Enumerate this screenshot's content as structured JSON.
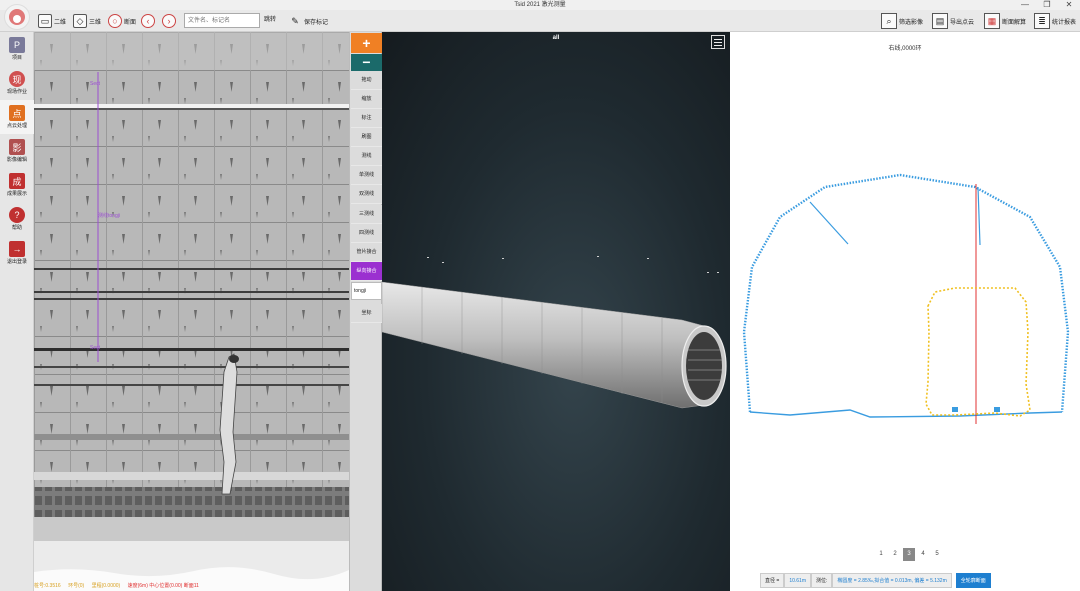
{
  "window": {
    "title": "Tsid 2021  激光测量",
    "controls": [
      "—",
      "❐",
      "✕"
    ]
  },
  "toolbar": {
    "view2d_label": "二维",
    "view3d_label": "三维",
    "section_label": "断面",
    "search_placeholder": "文件名、标记名",
    "search_btn": "跳转",
    "save_mark_label": "保存标记",
    "right": {
      "filter_image": "筛选影像",
      "export_pointcloud": "导出点云",
      "section_analysis": "断面解算",
      "stat_report": "统计报表"
    }
  },
  "sidebar": {
    "items": [
      {
        "label": "项目",
        "icon": "P"
      },
      {
        "label": "现场作业",
        "icon": "现"
      },
      {
        "label": "点云处理",
        "icon": "点"
      },
      {
        "label": "影像编辑",
        "icon": "影"
      },
      {
        "label": "成果展示",
        "icon": "成"
      },
      {
        "label": "帮助",
        "icon": "?"
      },
      {
        "label": "退出登录",
        "icon": "→"
      }
    ]
  },
  "scan": {
    "mark_top": "Sect",
    "mark_mid": "测线tongji",
    "mark_bottom": "Sect",
    "status": {
      "pos": "桩号:0.3516",
      "ring": "环号(0)",
      "mileage": "里程(0.0000)",
      "warn": "速度(6m)  中心位置(0.00)  断面11"
    }
  },
  "tools": {
    "add": "+",
    "sub": "−",
    "items": [
      "拖动",
      "缩放",
      "标注",
      "刷图",
      "测线",
      "单测线",
      "双测线",
      "三测线",
      "四测线",
      "管片接合"
    ],
    "active_item": "纵向接合",
    "input_value": "tongji",
    "coord": "坐标"
  },
  "view3d": {
    "label": "all"
  },
  "xsection": {
    "label": "右线,0000环",
    "pages": [
      "1",
      "2",
      "3",
      "4",
      "5"
    ],
    "active_page": "3",
    "footer": {
      "diameter_label": "直径 =",
      "diameter_value": "10.61m",
      "error_label": "测位:",
      "error_value": "椭圆度 = 2.85‰,拟合值 = 0.013m, 偏差 = 5.132m",
      "button": "全轮廓断面"
    }
  },
  "colors": {
    "accent_orange": "#f08024",
    "accent_teal": "#1b6a6a",
    "active_purple": "#9b30d0",
    "profile_blue": "#3a9ce0",
    "profile_yellow": "#f0c020",
    "axis_red": "#e03030"
  }
}
